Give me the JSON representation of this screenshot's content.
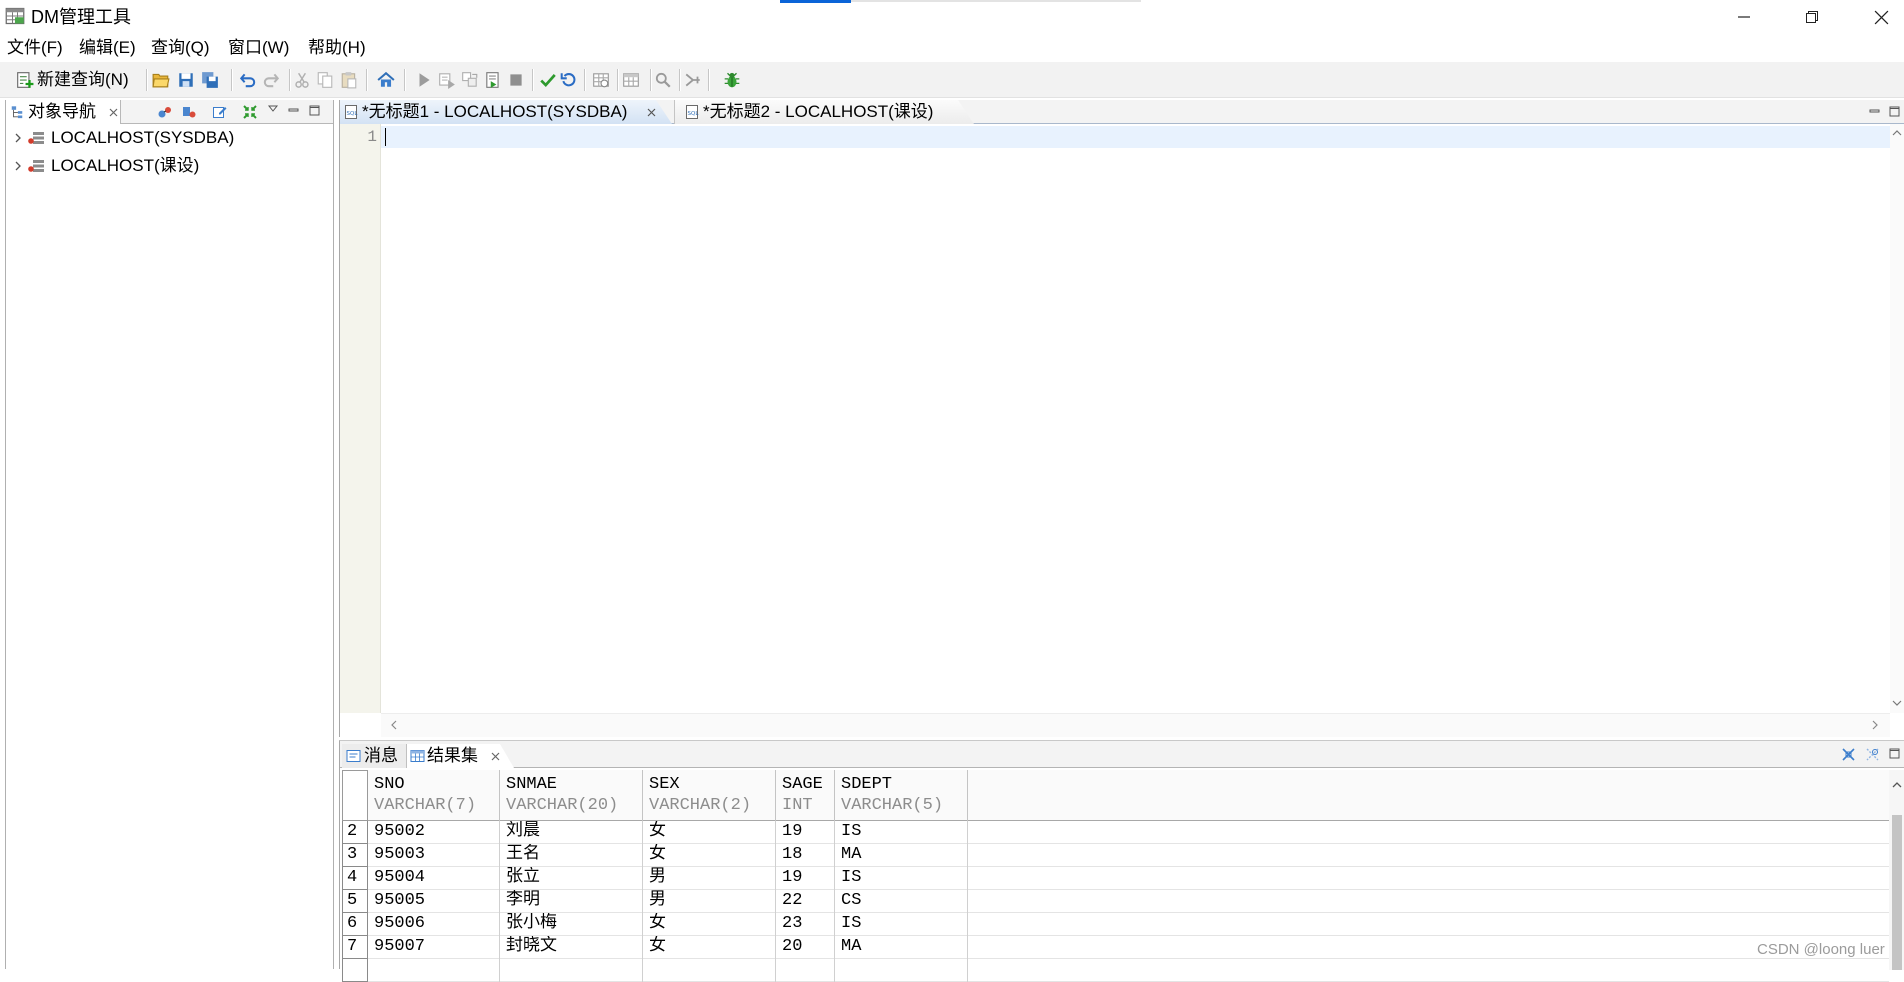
{
  "window": {
    "title": "DM管理工具",
    "icon": "dm-app-icon",
    "controls": [
      "minimize-icon",
      "restore-icon",
      "close-icon"
    ]
  },
  "menu": {
    "items": [
      "文件(F)",
      "编辑(E)",
      "查询(Q)",
      "窗口(W)",
      "帮助(H)"
    ]
  },
  "toolbar": {
    "new_query_label": "新建查询(N)",
    "icons": [
      "new-query-icon",
      "open-folder-icon",
      "save-icon",
      "save-all-icon",
      "undo-icon",
      "redo-icon",
      "cut-icon",
      "copy-icon",
      "paste-icon",
      "home-icon",
      "run-icon",
      "run-selection-icon",
      "step-icon",
      "run-script-icon",
      "stop-icon",
      "check-icon",
      "refresh-icon",
      "explain-plan-icon",
      "table-grid-icon",
      "search-icon",
      "toggle-icon",
      "debug-bug-icon"
    ]
  },
  "navigator": {
    "tab_label": "对象导航",
    "tree": [
      {
        "label": "LOCALHOST(SYSDBA)",
        "icon": "server-icon",
        "expanded": false
      },
      {
        "label": "LOCALHOST(课设)",
        "icon": "server-icon",
        "expanded": false
      }
    ]
  },
  "editor": {
    "tabs": [
      {
        "label": "*无标题1 - LOCALHOST(SYSDBA)",
        "active": true
      },
      {
        "label": "*无标题2 - LOCALHOST(课设)",
        "active": false
      }
    ],
    "line_numbers": [
      "1"
    ]
  },
  "results": {
    "tabs": [
      {
        "label": "消息",
        "active": false
      },
      {
        "label": "结果集",
        "active": true
      }
    ],
    "columns": [
      {
        "name": "SNO",
        "type": "VARCHAR(7)"
      },
      {
        "name": "SNMAE",
        "type": "VARCHAR(20)"
      },
      {
        "name": "SEX",
        "type": "VARCHAR(2)"
      },
      {
        "name": "SAGE",
        "type": "INT"
      },
      {
        "name": "SDEPT",
        "type": "VARCHAR(5)"
      }
    ],
    "rows": [
      {
        "num": "2",
        "cells": [
          "95002",
          "刘晨",
          "女",
          "19",
          "IS"
        ]
      },
      {
        "num": "3",
        "cells": [
          "95003",
          "王名",
          "女",
          "18",
          "MA"
        ]
      },
      {
        "num": "4",
        "cells": [
          "95004",
          "张立",
          "男",
          "19",
          "IS"
        ]
      },
      {
        "num": "5",
        "cells": [
          "95005",
          "李明",
          "男",
          "22",
          "CS"
        ]
      },
      {
        "num": "6",
        "cells": [
          "95006",
          "张小梅",
          "女",
          "23",
          "IS"
        ]
      },
      {
        "num": "7",
        "cells": [
          "95007",
          "封晓文",
          "女",
          "20",
          "MA"
        ]
      }
    ]
  },
  "watermark": "CSDN @loong luer",
  "colors": {
    "accent_blue": "#0a64d8",
    "active_tab": "#d3e2f4",
    "current_line": "#e8f2fe",
    "gutter": "#f4f4ec",
    "toolbar_bg": "#f2f2f2",
    "run_green": "#2e9a2e"
  }
}
